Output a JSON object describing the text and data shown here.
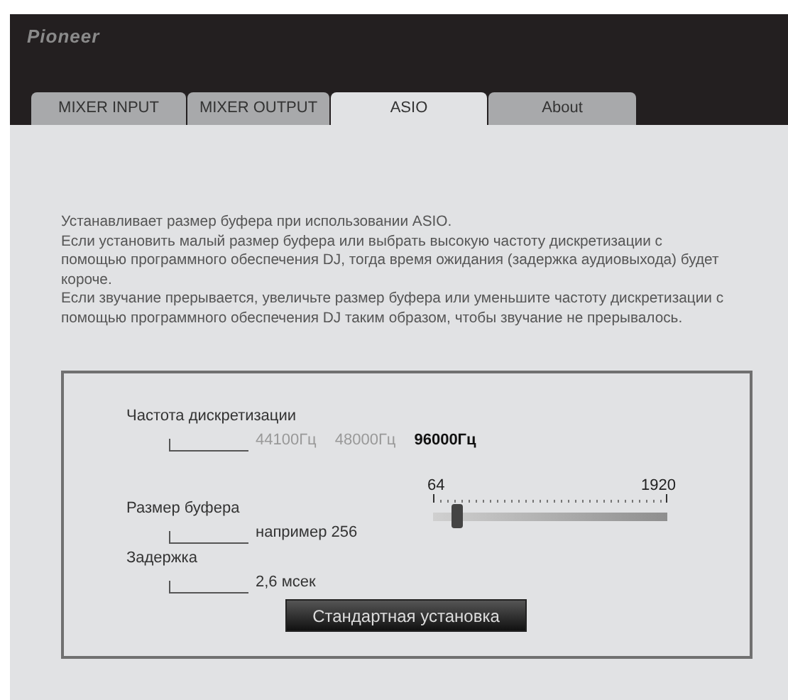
{
  "logo": "Pioneer",
  "tabs": [
    {
      "label": "MIXER INPUT",
      "selected": false
    },
    {
      "label": "MIXER OUTPUT",
      "selected": false
    },
    {
      "label": "ASIO",
      "selected": true
    },
    {
      "label": "About",
      "selected": false
    }
  ],
  "description": [
    "Устанавливает размер буфера при использовании ASIO.",
    "Если установить малый размер буфера или выбрать высокую частоту дискретизации с помощью программного обеспечения DJ, тогда время ожидания (задержка аудиовыхода) будет короче.",
    "Если звучание прерывается, увеличьте размер буфера или уменьшите частоту дискретизации с помощью программного обеспечения DJ таким образом, чтобы звучание не прерывалось."
  ],
  "sample_rate": {
    "label": "Частота дискретизации",
    "options": [
      {
        "label": "44100Гц",
        "selected": false
      },
      {
        "label": "48000Гц",
        "selected": false
      },
      {
        "label": "96000Гц",
        "selected": true
      }
    ]
  },
  "buffer_size": {
    "label": "Размер буфера",
    "value": "например 256",
    "min_label": "64",
    "max_label": "1920",
    "level": 0.1
  },
  "latency": {
    "label": "Задержка",
    "value": "2,6 мсек"
  },
  "default_button": "Стандартная установка"
}
